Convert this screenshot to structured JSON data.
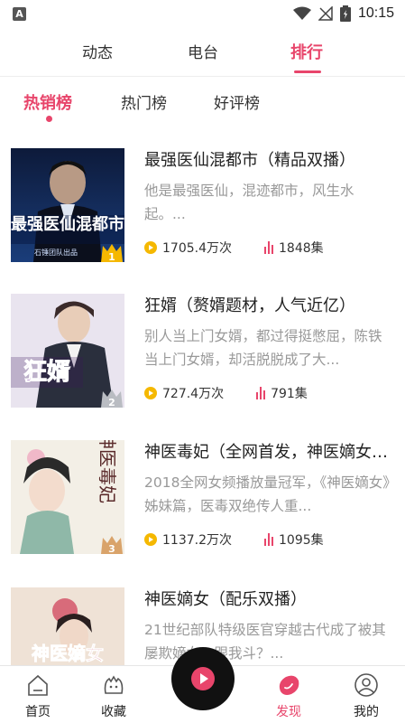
{
  "status_bar": {
    "app_badge": "A",
    "time": "10:15"
  },
  "top_tabs": [
    {
      "label": "动态",
      "active": false
    },
    {
      "label": "电台",
      "active": false
    },
    {
      "label": "排行",
      "active": true
    }
  ],
  "sub_tabs": [
    {
      "label": "热销榜",
      "active": true
    },
    {
      "label": "热门榜",
      "active": false
    },
    {
      "label": "好评榜",
      "active": false
    }
  ],
  "items": [
    {
      "title": "最强医仙混都市（精品双播）",
      "desc": "他是最强医仙，混迹都市，风生水起。...",
      "plays": "1705.4万次",
      "episodes": "1848集",
      "rank": "1",
      "cover_text": "最强医仙混都市",
      "cover_sub": "石锤团队出品"
    },
    {
      "title": "狂婿（赘婿题材，人气近亿）",
      "desc": "别人当上门女婿，都过得挺憋屈，陈铁当上门女婿，却活脱脱成了大...",
      "plays": "727.4万次",
      "episodes": "791集",
      "rank": "2",
      "cover_text": "狂婿"
    },
    {
      "title": "神医毒妃（全网首发，神医嫡女续篇）",
      "desc": "2018全网女频播放量冠军，《神医嫡女》姊妹篇，医毒双绝传人重...",
      "plays": "1137.2万次",
      "episodes": "1095集",
      "rank": "3",
      "cover_text": "神医毒妃"
    },
    {
      "title": "神医嫡女（配乐双播）",
      "desc": "21世纪部队特级医官穿越古代成了被其屡欺嫡女，跟我斗？...",
      "cover_text": "神医嫡女"
    }
  ],
  "bottom_nav": [
    {
      "label": "首页",
      "icon": "home-icon",
      "active": false
    },
    {
      "label": "收藏",
      "icon": "collection-icon",
      "active": false
    },
    {
      "label": "发现",
      "icon": "discover-icon",
      "active": true
    },
    {
      "label": "我的",
      "icon": "profile-icon",
      "active": false
    }
  ],
  "colors": {
    "accent": "#e8456b",
    "play_icon": "#f5b800"
  }
}
